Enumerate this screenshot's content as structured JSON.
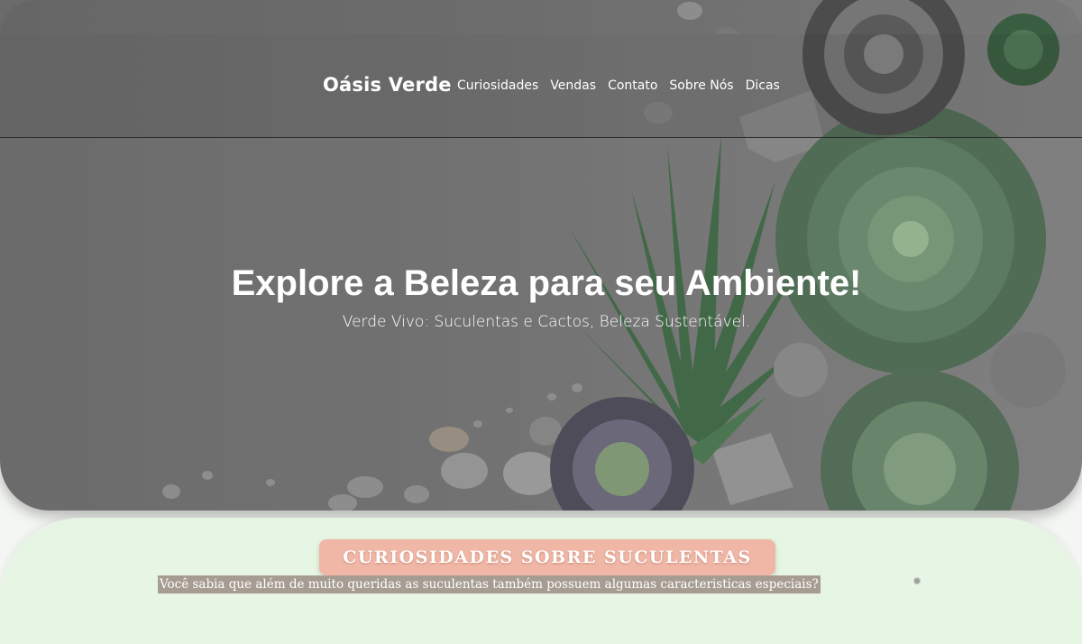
{
  "nav": {
    "brand": "Oásis Verde",
    "links": [
      "Curiosidades",
      "Vendas",
      "Contato",
      "Sobre Nós",
      "Dicas"
    ]
  },
  "hero": {
    "title": "Explore a Beleza para seu Ambiente!",
    "subtitle": "Verde Vivo: Suculentas e Cactos, Beleza Sustentável."
  },
  "curiosidades": {
    "heading": "CURIOSIDADES SOBRE SUCULENTAS",
    "intro": "Você sabia que além de muito queridas as suculentas também possuem algumas caracteristicas especiais?"
  },
  "colors": {
    "hero_overlay": "#767676",
    "section_bg": "#e7f5e4",
    "badge": "#f1b7a6",
    "intro_bg": "#a79c92"
  }
}
